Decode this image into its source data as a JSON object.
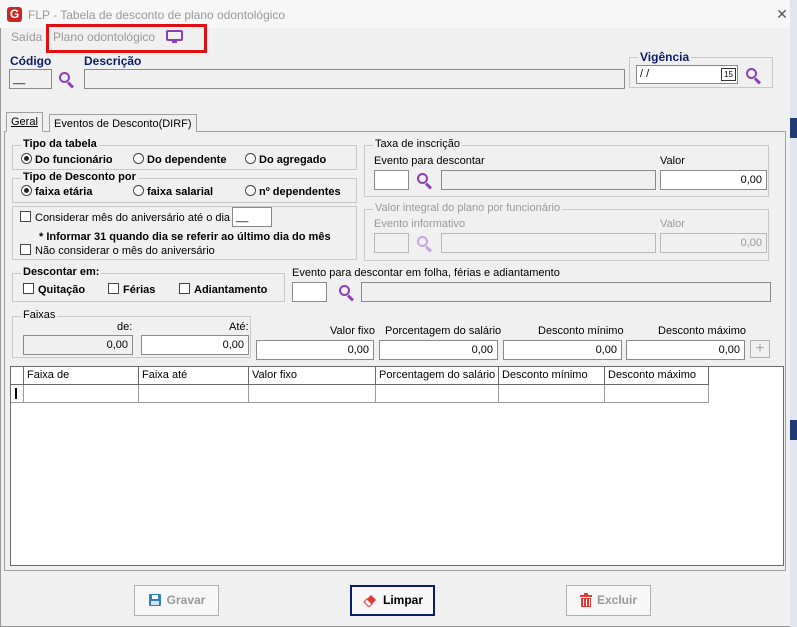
{
  "window": {
    "title": "FLP - Tabela de desconto de plano odontológico",
    "close": "✕"
  },
  "menu": {
    "exit": "Saída",
    "active": "Plano odontológico"
  },
  "header": {
    "codigo_label": "Código",
    "codigo_value": "__",
    "descricao_label": "Descrição",
    "descricao_value": "",
    "vigencia_label": "Vigência",
    "vigencia_value": " / /",
    "calendar_label": "15"
  },
  "tabs": [
    {
      "label": "Geral"
    },
    {
      "label": "Eventos de Desconto(DIRF)"
    }
  ],
  "tipo_tabela": {
    "label": "Tipo da tabela",
    "options": [
      {
        "label": "Do funcionário",
        "selected": true
      },
      {
        "label": "Do dependente",
        "selected": false
      },
      {
        "label": "Do agregado",
        "selected": false
      }
    ]
  },
  "tipo_desconto": {
    "label": "Tipo de Desconto por",
    "options": [
      {
        "label": "faixa etária",
        "selected": true
      },
      {
        "label": "faixa salarial",
        "selected": false
      },
      {
        "label": "nº dependentes",
        "selected": false
      }
    ]
  },
  "taxa": {
    "label": "Taxa de inscrição",
    "evento_label": "Evento para descontar",
    "evento_value": "",
    "valor_label": "Valor",
    "valor_value": "0,00"
  },
  "aniversario": {
    "considerar_label": "Considerar mês do aniversário até o dia",
    "dia_value": "__",
    "note": "* Informar 31 quando dia se referir ao último dia do mês",
    "nao_considerar_label": "Não considerar o mês do aniversário"
  },
  "integral": {
    "label": "Valor integral do plano por funcionário",
    "evento_label": "Evento informativo",
    "valor_label": "Valor",
    "valor_value": "0,00"
  },
  "descontar": {
    "label": "Descontar em:",
    "options": [
      {
        "label": "Quitação"
      },
      {
        "label": "Férias"
      },
      {
        "label": "Adiantamento"
      }
    ]
  },
  "evento_folha": {
    "label": "Evento para descontar em folha, férias e adiantamento",
    "value": ""
  },
  "faixas": {
    "label": "Faixas",
    "de_label": "de:",
    "de_value": "0,00",
    "ate_label": "Até:",
    "ate_value": "0,00",
    "valor_fixo_label": "Valor fixo",
    "valor_fixo_value": "0,00",
    "perc_label": "Porcentagem do salário",
    "perc_value": "0,00",
    "min_label": "Desconto mínimo",
    "min_value": "0,00",
    "max_label": "Desconto máximo",
    "max_value": "0,00",
    "add": "+"
  },
  "grid": {
    "columns": [
      "Faixa de",
      "Faixa até",
      "Valor fixo",
      "Porcentagem do salário",
      "Desconto mínimo",
      "Desconto máximo"
    ]
  },
  "buttons": {
    "gravar": "Gravar",
    "limpar": "Limpar",
    "excluir": "Excluir"
  },
  "colors": {
    "accent": "#0a1d6b",
    "highlight": "#e01010",
    "search": "#8b3fb8",
    "brand": "#c62828"
  },
  "icons": {
    "app": "flp-logo-icon",
    "search": "search-icon",
    "monitor": "monitor-icon",
    "save": "floppy-icon",
    "clear": "eraser-icon",
    "delete": "trash-icon"
  }
}
